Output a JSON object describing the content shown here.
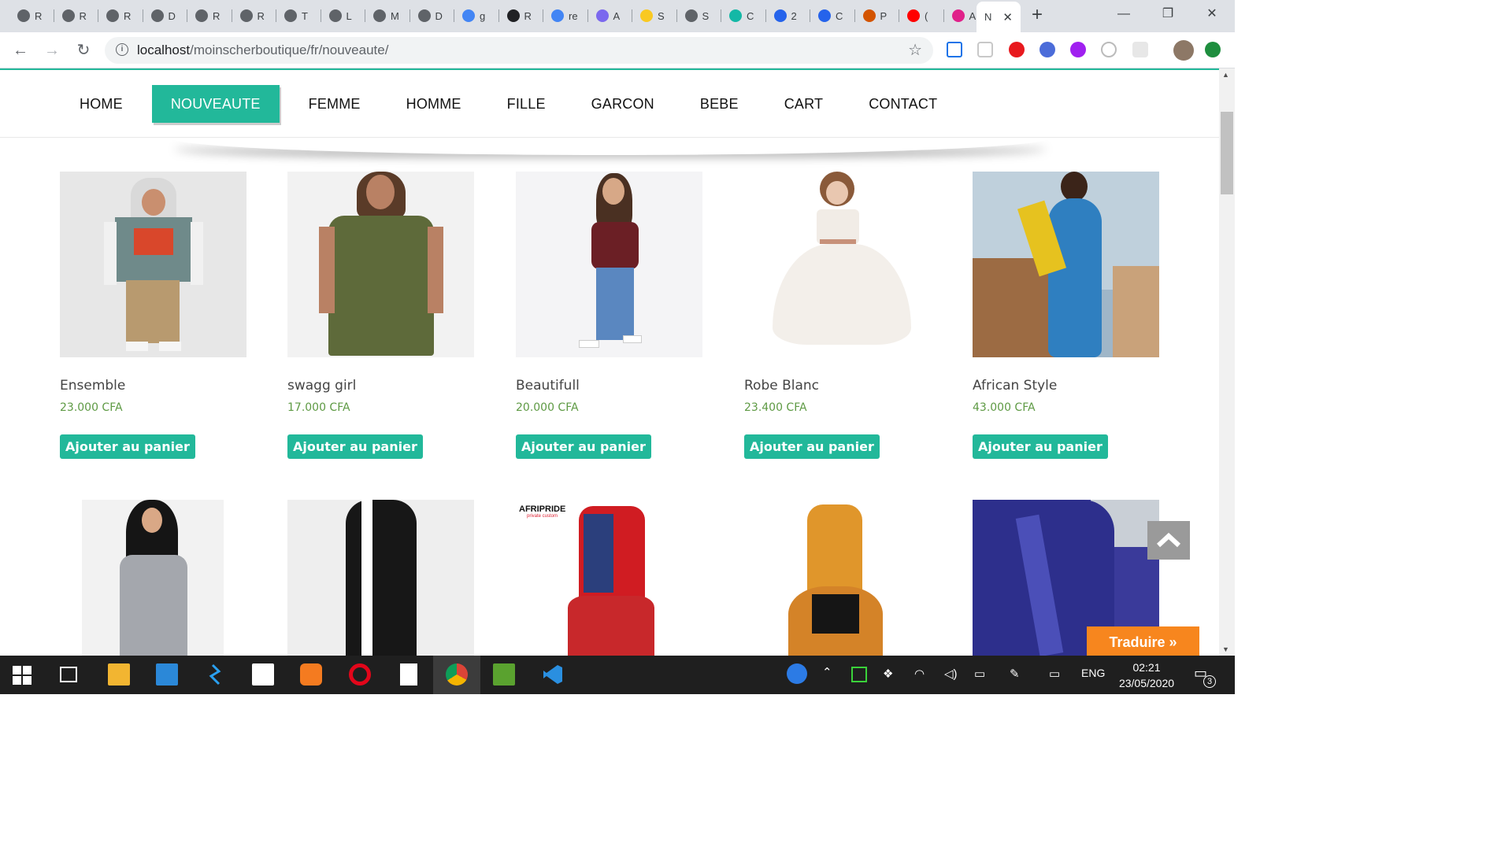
{
  "browser": {
    "tabs": [
      {
        "letter": "R",
        "color": "#5f6368"
      },
      {
        "letter": "R",
        "color": "#5f6368"
      },
      {
        "letter": "R",
        "color": "#5f6368"
      },
      {
        "letter": "D",
        "color": "#5f6368"
      },
      {
        "letter": "R",
        "color": "#5f6368"
      },
      {
        "letter": "R",
        "color": "#5f6368"
      },
      {
        "letter": "T",
        "color": "#5f6368"
      },
      {
        "letter": "L",
        "color": "#5f6368"
      },
      {
        "letter": "M",
        "color": "#5f6368"
      },
      {
        "letter": "D",
        "color": "#5f6368"
      },
      {
        "letter": "g",
        "color": "#4285f4"
      },
      {
        "letter": "R",
        "color": "#202124"
      },
      {
        "letter": "re",
        "color": "#4285f4"
      },
      {
        "letter": "A",
        "color": "#7b68ee"
      },
      {
        "letter": "S",
        "color": "#f9c922"
      },
      {
        "letter": "S",
        "color": "#5f6368"
      },
      {
        "letter": "C",
        "color": "#14b8a6"
      },
      {
        "letter": "2",
        "color": "#2563eb"
      },
      {
        "letter": "C",
        "color": "#2563eb"
      },
      {
        "letter": "P",
        "color": "#d35400"
      },
      {
        "letter": "(",
        "color": "#ff0000"
      },
      {
        "letter": "A",
        "color": "#e0218a"
      }
    ],
    "active_tab": {
      "letter": "N",
      "close": "✕"
    },
    "new_tab": "+",
    "window_controls": {
      "minimize": "—",
      "maximize": "❐",
      "close": "✕"
    },
    "nav": {
      "back": "←",
      "forward": "→",
      "reload": "↻"
    },
    "url_host": "localhost",
    "url_path": "/moinscherboutique/fr/nouveaute/",
    "info_icon": "i",
    "bookmark_icon": "☆"
  },
  "site": {
    "menu": [
      "HOME",
      "NOUVEAUTE",
      "FEMME",
      "HOMME",
      "FILLE",
      "GARCON",
      "BEBE",
      "CART",
      "CONTACT"
    ],
    "active_menu": "NOUVEAUTE",
    "accent_color": "#22b89a",
    "price_color": "#5e9a44",
    "products": [
      {
        "name": "Ensemble",
        "price": "23.000 CFA",
        "button": "Ajouter au panier"
      },
      {
        "name": "swagg girl",
        "price": "17.000 CFA",
        "button": "Ajouter au panier"
      },
      {
        "name": "Beautifull",
        "price": "20.000 CFA",
        "button": "Ajouter au panier"
      },
      {
        "name": "Robe Blanc",
        "price": "23.400 CFA",
        "button": "Ajouter au panier"
      },
      {
        "name": "African Style",
        "price": "43.000 CFA",
        "button": "Ajouter au panier"
      }
    ],
    "brand_logo": "AFRIPRIDE",
    "brand_logo_sub": "private custom",
    "translate_button": "Traduire »",
    "scroll_top_icon": "chevron-up-icon"
  },
  "taskbar": {
    "language": "ENG",
    "time": "02:21",
    "date": "23/05/2020",
    "notification_count": "3"
  }
}
